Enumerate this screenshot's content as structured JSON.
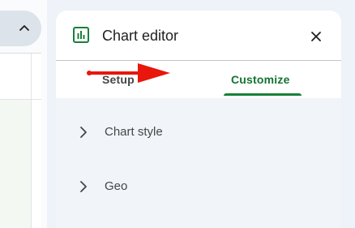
{
  "sidebar_toggle": {
    "icon": "chevron-up-icon"
  },
  "chart_editor": {
    "title": "Chart editor",
    "header_icon": "chart-icon",
    "close_icon": "close-icon",
    "tabs": [
      {
        "label": "Setup",
        "active": false
      },
      {
        "label": "Customize",
        "active": true
      }
    ],
    "sections": [
      {
        "label": "Chart style",
        "icon": "chevron-right-icon"
      },
      {
        "label": "Geo",
        "icon": "chevron-right-icon"
      }
    ]
  },
  "annotation": {
    "type": "red-arrow",
    "color": "#e8160c"
  },
  "colors": {
    "accent": "#188038",
    "active_tab_text": "#137333",
    "panel_bg": "#ffffff",
    "section_bg": "#f1f4f9",
    "page_bg": "#eef2f9"
  }
}
